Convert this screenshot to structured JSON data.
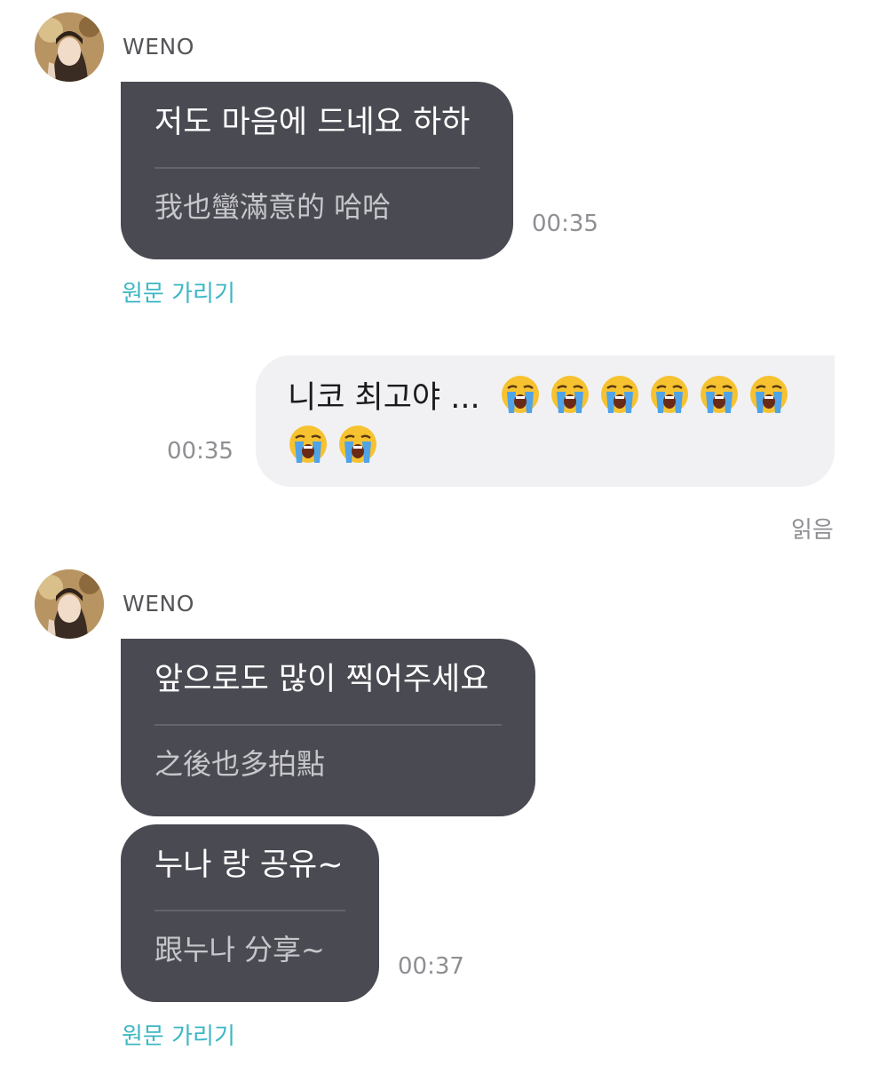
{
  "messages": [
    {
      "sender": "WENO",
      "original": "저도 마음에 드네요 하하",
      "translation": "我也蠻滿意的 哈哈",
      "time": "00:35",
      "toggle": "원문 가리기"
    },
    {
      "outgoing": true,
      "text": "니코 최고야 ...",
      "emoji": "loudly-crying-face",
      "emoji_count": 8,
      "time": "00:35",
      "status": "읽음"
    },
    {
      "sender": "WENO",
      "original": "앞으로도 많이 찍어주세요",
      "translation": "之後也多拍點"
    },
    {
      "original": "누나 랑 공유~",
      "translation": "跟누나 分享~",
      "time": "00:37",
      "toggle": "원문 가리기"
    }
  ],
  "colors": {
    "incoming_bubble": "#4a4a52",
    "outgoing_bubble": "#f1f1f4",
    "toggle_link": "#3cb7c4",
    "timestamp": "#8e8e93"
  }
}
